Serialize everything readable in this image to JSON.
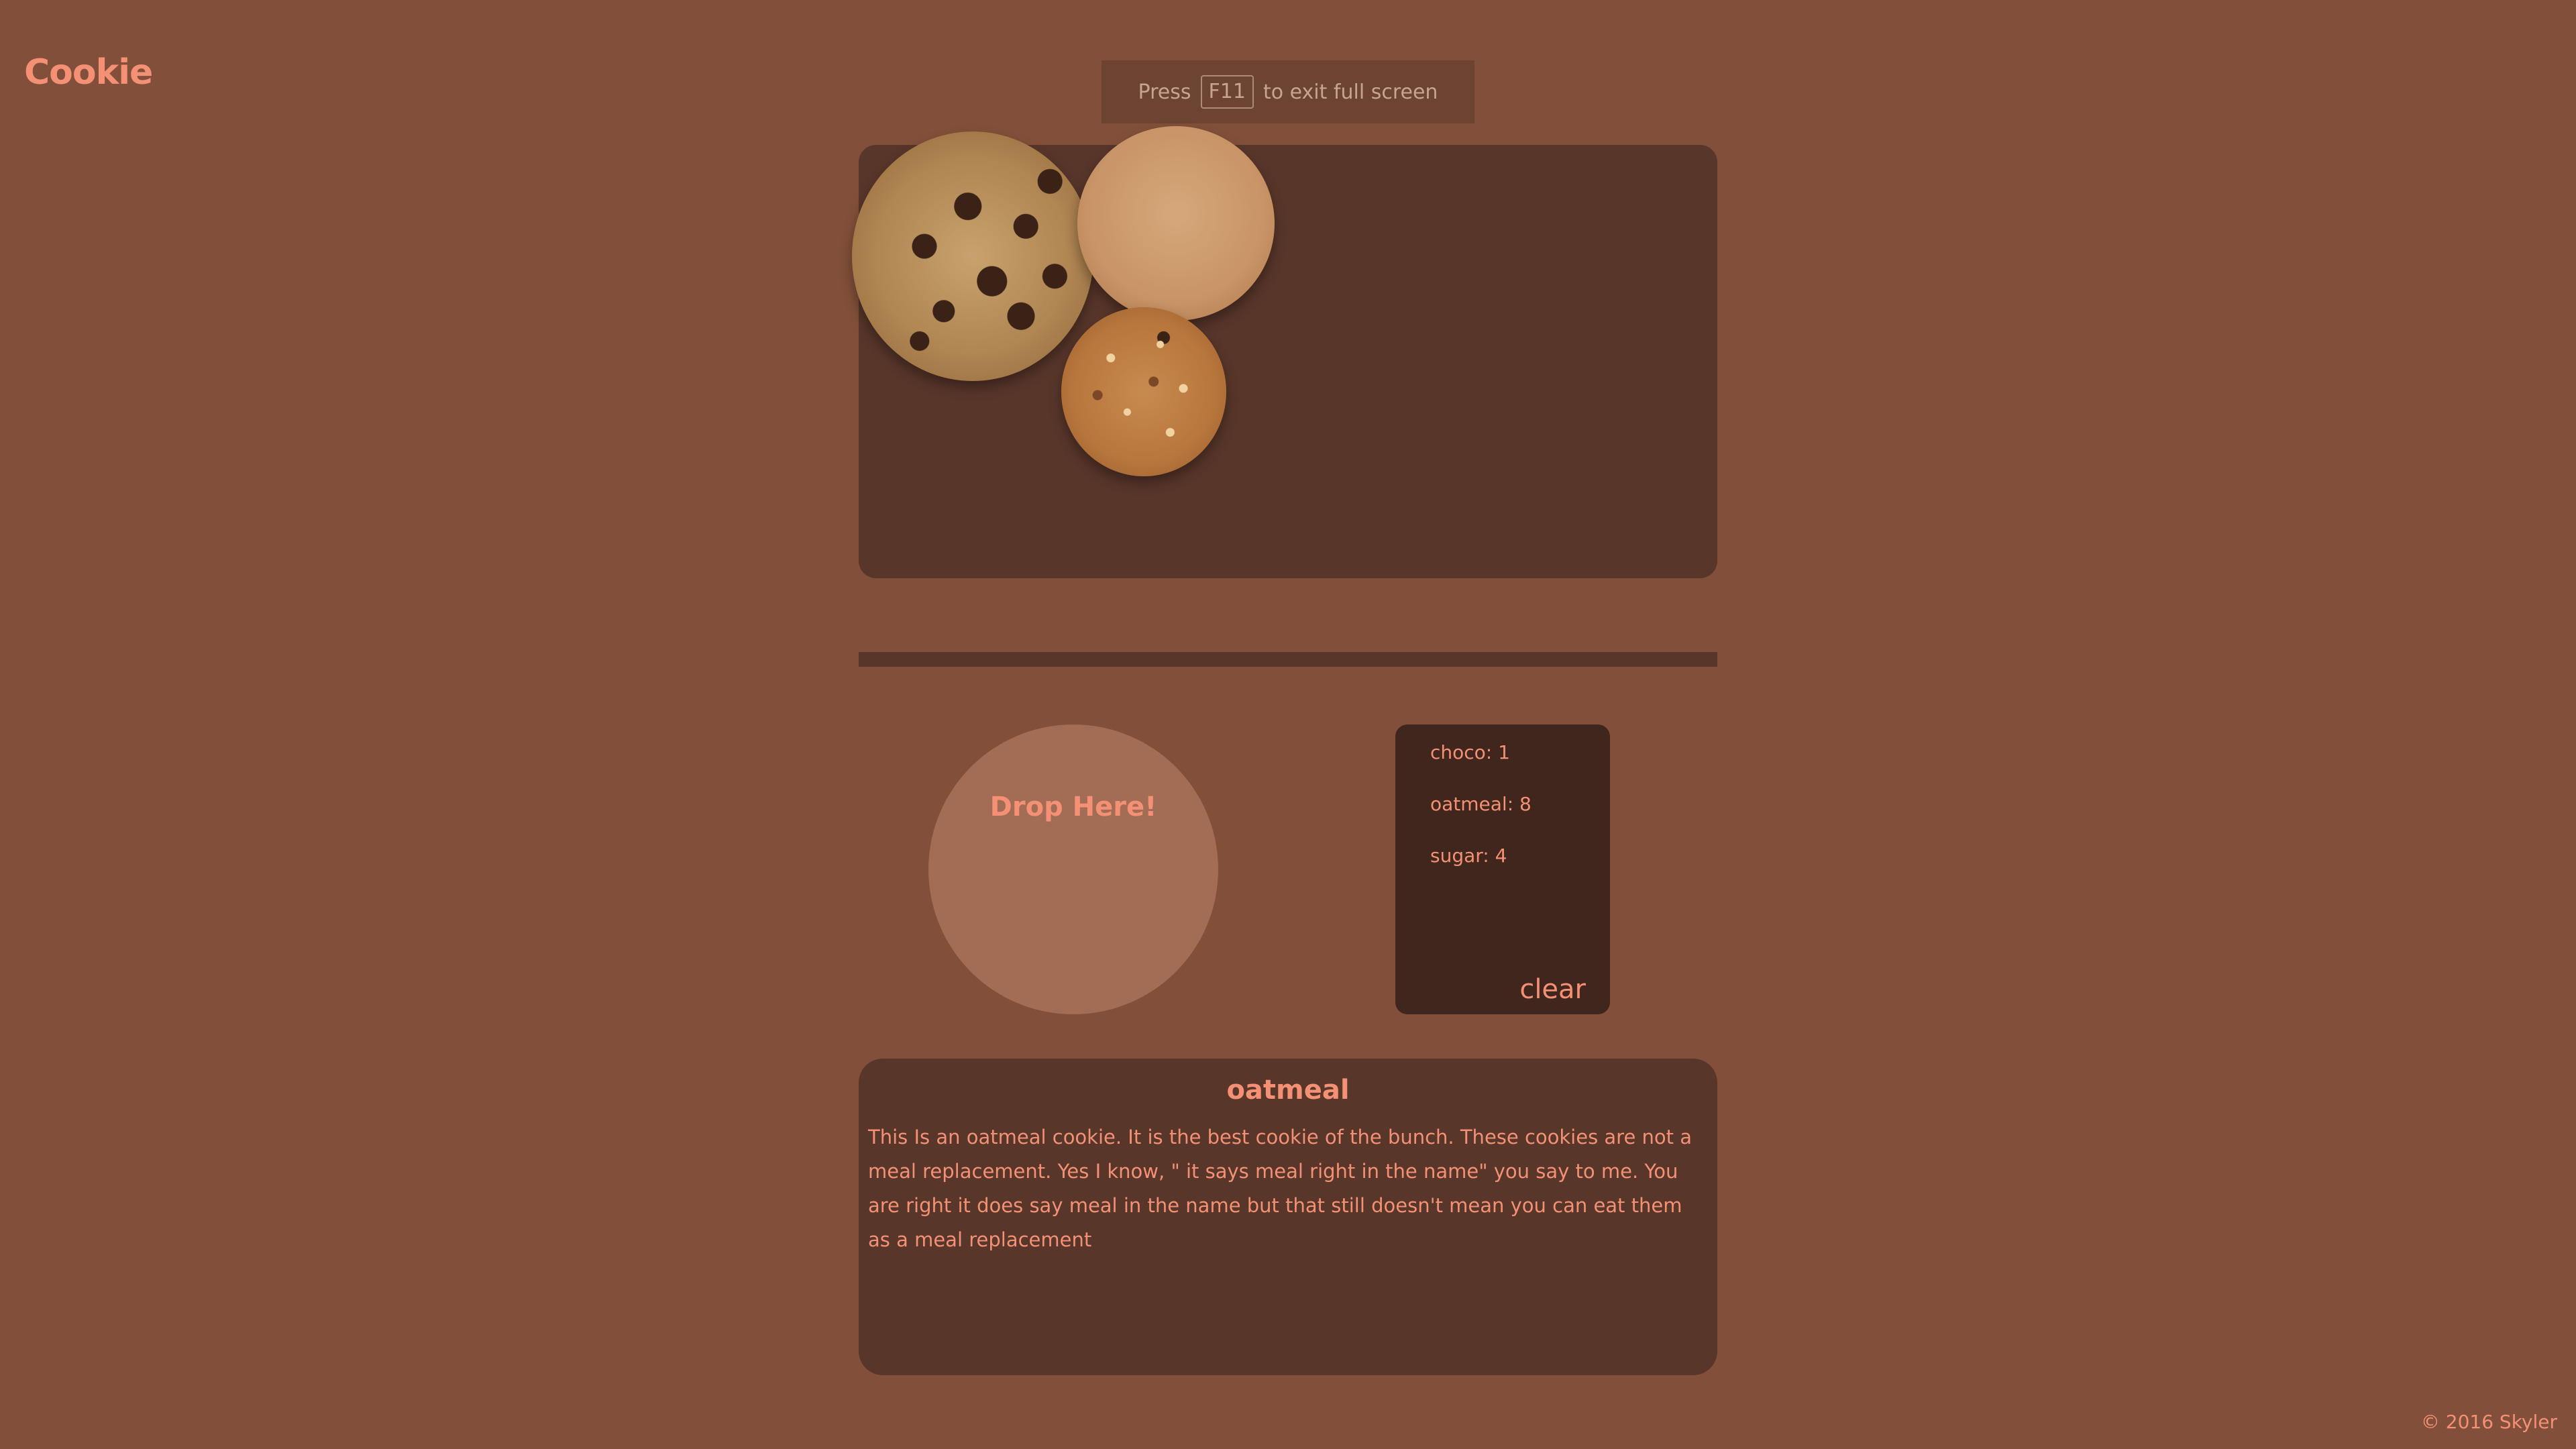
{
  "app": {
    "logo": "Cookie"
  },
  "fullscreen_notice": {
    "prefix": "Press",
    "key": "F11",
    "suffix": "to exit full screen"
  },
  "cookies": [
    {
      "name": "choco",
      "icon": "chocolate-chip-cookie-icon"
    },
    {
      "name": "sugar",
      "icon": "sugar-cookie-icon"
    },
    {
      "name": "oatmeal",
      "icon": "oatmeal-cookie-icon"
    }
  ],
  "drop_zone": {
    "label": "Drop Here!"
  },
  "counter": {
    "items": [
      {
        "label": "choco: 1"
      },
      {
        "label": "oatmeal: 8"
      },
      {
        "label": "sugar: 4"
      }
    ],
    "clear_label": "clear"
  },
  "info": {
    "title": "oatmeal",
    "description": "This Is an oatmeal cookie. It is the best cookie of the bunch. These cookies are not a meal replacement. Yes I know, \" it says meal right in the name\" you say to me. You are right it does say meal in the name but that still doesn't mean you can eat them as a meal replacement"
  },
  "footer": {
    "text": "© 2016 Skyler"
  },
  "colors": {
    "background": "#82503a",
    "panel": "#58362a",
    "panel_dark": "#40261c",
    "accent": "#f49175",
    "drop_zone": "#a36c55"
  }
}
